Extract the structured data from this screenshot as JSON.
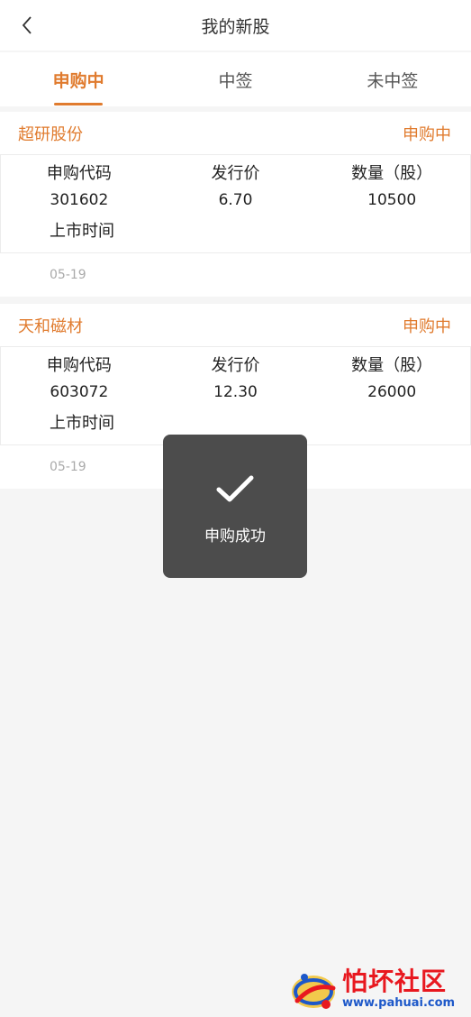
{
  "header": {
    "title": "我的新股"
  },
  "tabs": [
    {
      "label": "申购中",
      "active": true
    },
    {
      "label": "中签",
      "active": false
    },
    {
      "label": "未中签",
      "active": false
    }
  ],
  "labels": {
    "code": "申购代码",
    "price": "发行价",
    "quantity": "数量（股）",
    "listing": "上市时间"
  },
  "stocks": [
    {
      "name": "超研股份",
      "status": "申购中",
      "code": "301602",
      "price": "6.70",
      "quantity": "10500",
      "date": "05-19"
    },
    {
      "name": "天和磁材",
      "status": "申购中",
      "code": "603072",
      "price": "12.30",
      "quantity": "26000",
      "date": "05-19"
    }
  ],
  "toast": {
    "message": "申购成功",
    "icon": "check-icon"
  },
  "watermark": {
    "title": "怕坏社区",
    "url": "www.pahuai.com"
  },
  "colors": {
    "accent": "#e07b2e",
    "toast_bg": "#4c4c4c",
    "background": "#f5f5f5"
  }
}
